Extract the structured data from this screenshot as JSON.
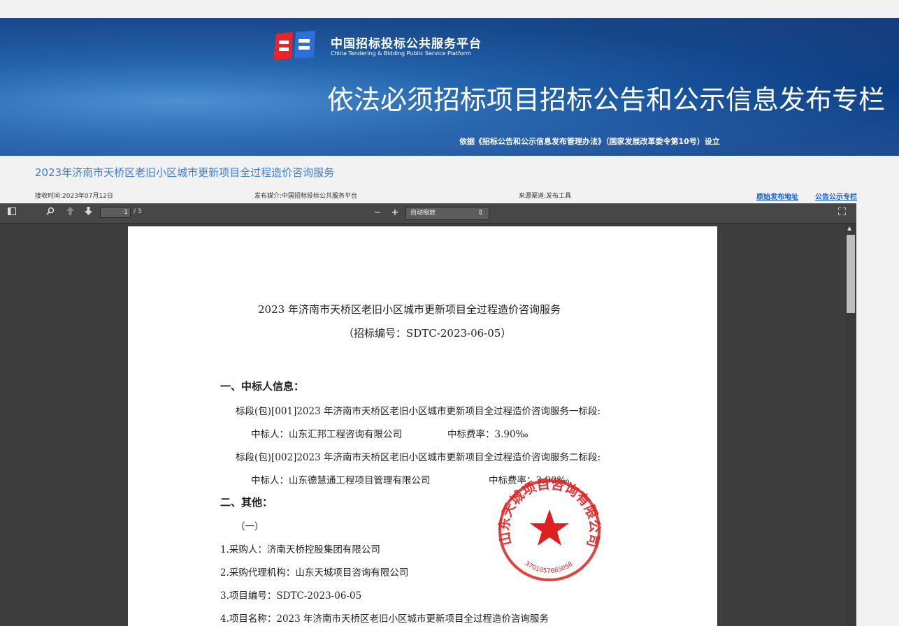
{
  "banner": {
    "logo_cn": "中国招标投标公共服务平台",
    "logo_en": "China Tendering & Bidding Public Service Platform",
    "title": "依法必须招标项目招标公告和公示信息发布专栏",
    "subtitle": "依据《招标公告和公示信息发布管理办法》（国家发展改革委令第10号）设立"
  },
  "page_title": "2023年济南市天桥区老旧小区城市更新项目全过程造价咨询服务",
  "meta": {
    "received": "接收时间:2023年07月12日",
    "media": "发布媒介:中国招标投标公共服务平台",
    "channel": "来源渠道:发布工具",
    "link_original": "原始发布地址",
    "link_column": "公告公示专栏"
  },
  "viewer": {
    "page_current": "1",
    "page_total": "/ 3",
    "zoom_label": "自动缩放",
    "zoom_out": "−",
    "zoom_in": "+"
  },
  "document": {
    "title": "2023 年济南市天桥区老旧小区城市更新项目全过程造价咨询服务",
    "code": "（招标编号：SDTC-2023-06-05）",
    "section1": "一、中标人信息：",
    "lot1": "标段(包)[001]2023 年济南市天桥区老旧小区城市更新项目全过程造价咨询服务一标段:",
    "lot1_winner": "中标人：山东汇邦工程咨询有限公司",
    "lot1_rate": "中标费率：3.90‰",
    "lot2": "标段(包)[002]2023 年济南市天桥区老旧小区城市更新项目全过程造价咨询服务二标段:",
    "lot2_winner": "中标人：山东德慧通工程项目管理有限公司",
    "lot2_rate": "中标费率：3.90‰",
    "section2": "二、其他：",
    "sub1": "（一）",
    "item1": "1.采购人：济南天桥控股集团有限公司",
    "item2": "2.采购代理机构：山东天城项目咨询有限公司",
    "item3": "3.项目编号：SDTC-2023-06-05",
    "item4": "4.项目名称：2023 年济南市天桥区老旧小区城市更新项目全过程造价咨询服务"
  },
  "seal": {
    "text": "山东天城项目咨询有限公司",
    "number": "3701057665058",
    "color": "#e02020"
  },
  "colors": {
    "link": "#1a5fc8",
    "title": "#3d7fd6",
    "banner": "#0d3f86"
  }
}
